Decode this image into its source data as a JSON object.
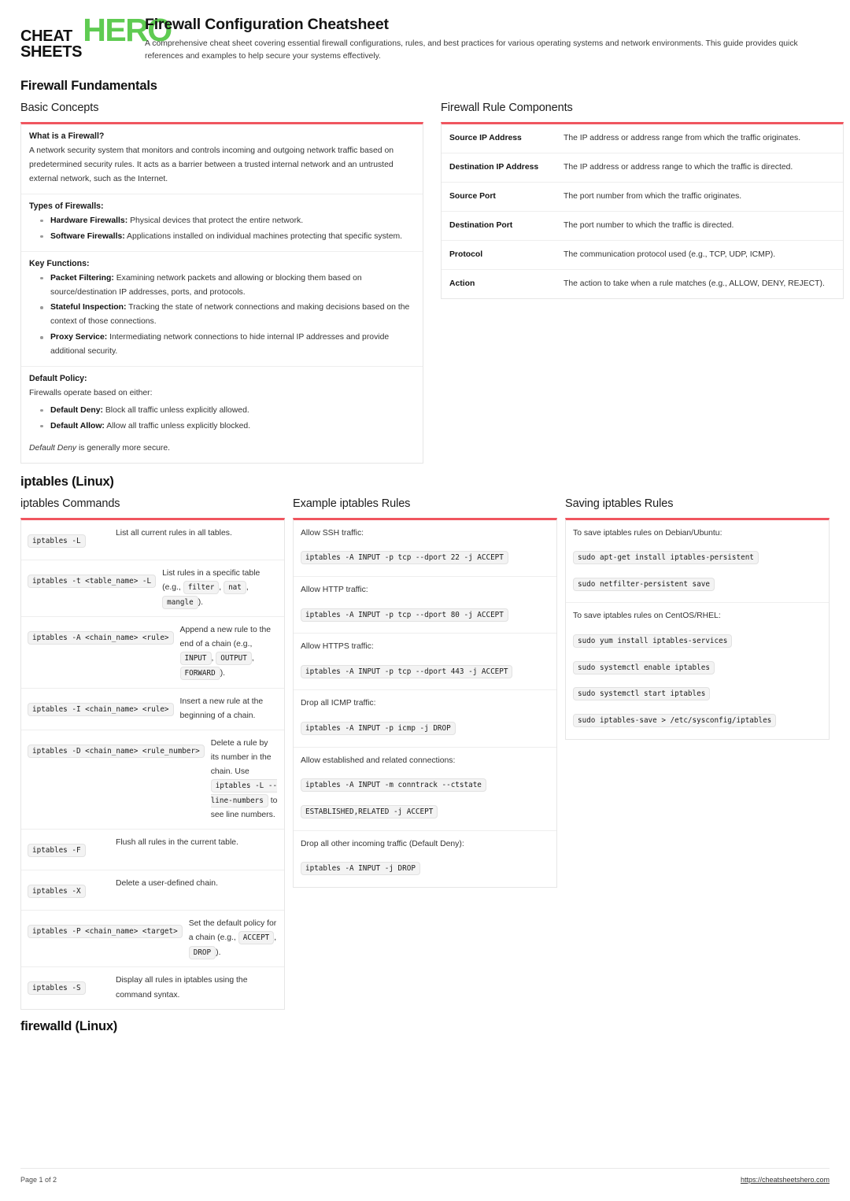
{
  "brand": {
    "line1": "CHEAT",
    "line2": "SHEETS",
    "hero": "HERO",
    "hero_color": "#5fcb52"
  },
  "accent_color": "#f0565f",
  "header": {
    "title": "Firewall Configuration Cheatsheet",
    "subtitle": "A comprehensive cheat sheet covering essential firewall configurations, rules, and best practices for various operating systems and network environments. This guide provides quick references and examples to help secure your systems effectively."
  },
  "sections": {
    "fundamentals": {
      "title": "Firewall Fundamentals",
      "basic_concepts": {
        "title": "Basic Concepts",
        "what_is": {
          "heading": "What is a Firewall?",
          "body": "A network security system that monitors and controls incoming and outgoing network traffic based on predetermined security rules. It acts as a barrier between a trusted internal network and an untrusted external network, such as the Internet."
        },
        "types": {
          "heading": "Types of Firewalls:",
          "items": [
            {
              "term": "Hardware Firewalls:",
              "desc": " Physical devices that protect the entire network."
            },
            {
              "term": "Software Firewalls:",
              "desc": " Applications installed on individual machines protecting that specific system."
            }
          ]
        },
        "key_functions": {
          "heading": "Key Functions:",
          "items": [
            {
              "term": "Packet Filtering:",
              "desc": " Examining network packets and allowing or blocking them based on source/destination IP addresses, ports, and protocols."
            },
            {
              "term": "Stateful Inspection:",
              "desc": " Tracking the state of network connections and making decisions based on the context of those connections."
            },
            {
              "term": "Proxy Service:",
              "desc": " Intermediating network connections to hide internal IP addresses and provide additional security."
            }
          ]
        },
        "default_policy": {
          "heading": "Default Policy:",
          "intro": "Firewalls operate based on either:",
          "items": [
            {
              "term": "Default Deny:",
              "desc": " Block all traffic unless explicitly allowed."
            },
            {
              "term": "Default Allow:",
              "desc": " Allow all traffic unless explicitly blocked."
            }
          ],
          "note_italic": "Default Deny",
          "note_rest": " is generally more secure."
        }
      },
      "rule_components": {
        "title": "Firewall Rule Components",
        "rows": [
          {
            "key": "Source IP Address",
            "value": "The IP address or address range from which the traffic originates."
          },
          {
            "key": "Destination IP Address",
            "value": "The IP address or address range to which the traffic is directed."
          },
          {
            "key": "Source Port",
            "value": "The port number from which the traffic originates."
          },
          {
            "key": "Destination Port",
            "value": "The port number to which the traffic is directed."
          },
          {
            "key": "Protocol",
            "value": "The communication protocol used (e.g., TCP, UDP, ICMP)."
          },
          {
            "key": "Action",
            "value": "The action to take when a rule matches (e.g., ALLOW, DENY, REJECT)."
          }
        ]
      }
    },
    "iptables": {
      "title": "iptables (Linux)",
      "commands": {
        "title": "iptables Commands",
        "rows": [
          {
            "cmd": "iptables -L",
            "desc": "List all current rules in all tables."
          },
          {
            "cmd": "iptables -t <table_name> -L",
            "desc_pre": "List rules in a specific table (e.g., ",
            "chips": [
              "filter",
              "nat",
              "mangle"
            ],
            "desc_post": ")."
          },
          {
            "cmd": "iptables -A <chain_name> <rule>",
            "desc_pre": "Append a new rule to the end of a chain (e.g., ",
            "chips": [
              "INPUT",
              "OUTPUT",
              "FORWARD"
            ],
            "desc_post": ")."
          },
          {
            "cmd": "iptables -I <chain_name> <rule>",
            "desc": "Insert a new rule at the beginning of a chain."
          },
          {
            "cmd": "iptables -D <chain_name> <rule_number>",
            "desc_pre": "Delete a rule by its number in the chain. Use ",
            "chips": [
              "iptables -L --line-numbers"
            ],
            "desc_post": " to see line numbers."
          },
          {
            "cmd": "iptables -F",
            "desc": "Flush all rules in the current table."
          },
          {
            "cmd": "iptables -X",
            "desc": "Delete a user-defined chain."
          },
          {
            "cmd": "iptables -P <chain_name> <target>",
            "desc_pre": "Set the default policy for a chain (e.g., ",
            "chips": [
              "ACCEPT",
              "DROP"
            ],
            "desc_post": ")."
          },
          {
            "cmd": "iptables -S",
            "desc": "Display all rules in iptables using the command syntax."
          }
        ]
      },
      "examples": {
        "title": "Example iptables Rules",
        "rows": [
          {
            "label": "Allow SSH traffic:",
            "codes": [
              "iptables -A INPUT -p tcp --dport 22 -j ACCEPT"
            ]
          },
          {
            "label": "Allow HTTP traffic:",
            "codes": [
              "iptables -A INPUT -p tcp --dport 80 -j ACCEPT"
            ]
          },
          {
            "label": "Allow HTTPS traffic:",
            "codes": [
              "iptables -A INPUT -p tcp --dport 443 -j ACCEPT"
            ]
          },
          {
            "label": "Drop all ICMP traffic:",
            "codes": [
              "iptables -A INPUT -p icmp -j DROP"
            ]
          },
          {
            "label": "Allow established and related connections:",
            "codes": [
              "iptables -A INPUT -m conntrack --ctstate",
              "ESTABLISHED,RELATED -j ACCEPT"
            ]
          },
          {
            "label": "Drop all other incoming traffic (Default Deny):",
            "codes": [
              "iptables -A INPUT -j DROP"
            ]
          }
        ]
      },
      "saving": {
        "title": "Saving iptables Rules",
        "rows": [
          {
            "label": "To save iptables rules on Debian/Ubuntu:",
            "codes": [
              "sudo apt-get install iptables-persistent",
              "sudo netfilter-persistent save"
            ]
          },
          {
            "label": "To save iptables rules on CentOS/RHEL:",
            "codes": [
              "sudo yum install iptables-services",
              "sudo systemctl enable iptables",
              "sudo systemctl start iptables",
              "sudo iptables-save > /etc/sysconfig/iptables"
            ]
          }
        ]
      }
    },
    "firewalld": {
      "title": "firewalld (Linux)"
    }
  },
  "footer": {
    "page": "Page 1 of 2",
    "url": "https://cheatsheetshero.com"
  }
}
